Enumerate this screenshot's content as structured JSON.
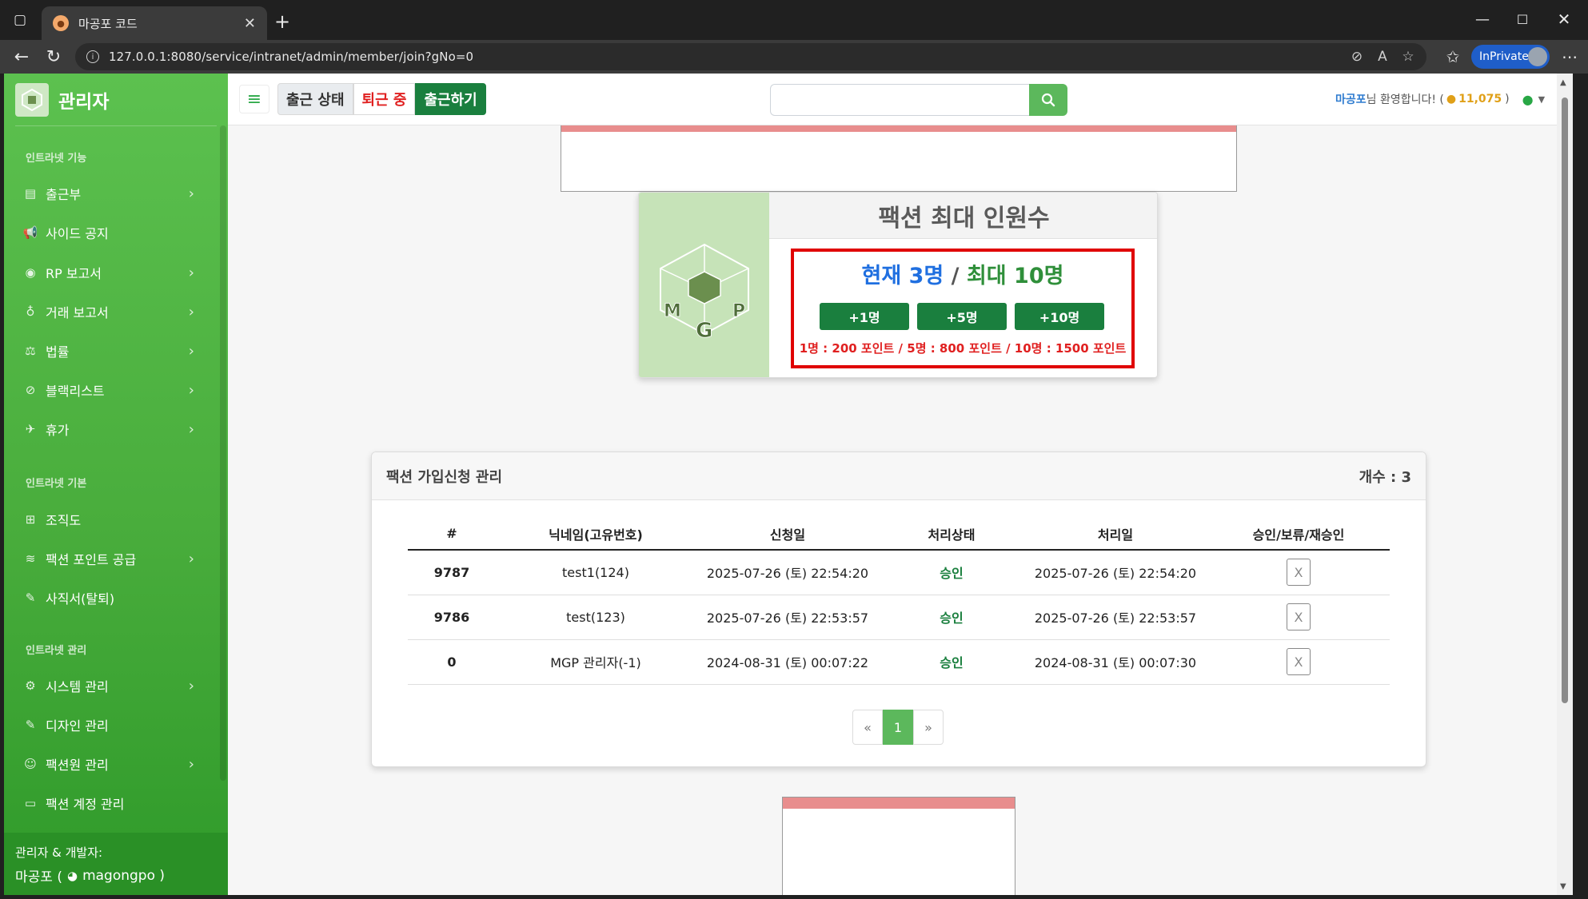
{
  "browser": {
    "tab_title": "마공포 코드",
    "url": "127.0.0.1:8080/service/intranet/admin/member/join?gNo=0",
    "inprivate_label": "InPrivate"
  },
  "sidebar": {
    "brand_title": "관리자",
    "sections": [
      {
        "heading": "인트라넷 기능",
        "items": [
          {
            "label": "출근부",
            "icon": "book-icon",
            "has_children": true
          },
          {
            "label": "사이드 공지",
            "icon": "megaphone-icon",
            "has_children": false
          },
          {
            "label": "RP 보고서",
            "icon": "gamepad-icon",
            "has_children": true
          },
          {
            "label": "거래 보고서",
            "icon": "moneybag-icon",
            "has_children": true
          },
          {
            "label": "법률",
            "icon": "scale-icon",
            "has_children": true
          },
          {
            "label": "블랙리스트",
            "icon": "ban-icon",
            "has_children": true
          },
          {
            "label": "휴가",
            "icon": "plane-icon",
            "has_children": true
          }
        ]
      },
      {
        "heading": "인트라넷 기본",
        "items": [
          {
            "label": "조직도",
            "icon": "sitemap-icon",
            "has_children": false
          },
          {
            "label": "팩션 포인트 공급",
            "icon": "coins-icon",
            "has_children": true
          },
          {
            "label": "사직서(탈퇴)",
            "icon": "feather-icon",
            "has_children": false
          }
        ]
      },
      {
        "heading": "인트라넷 관리",
        "items": [
          {
            "label": "시스템 관리",
            "icon": "gear-icon",
            "has_children": true
          },
          {
            "label": "디자인 관리",
            "icon": "brush-icon",
            "has_children": false
          },
          {
            "label": "팩션원 관리",
            "icon": "user-gear-icon",
            "has_children": true
          },
          {
            "label": "팩션 계정 관리",
            "icon": "id-card-icon",
            "has_children": false
          }
        ]
      }
    ],
    "footer": {
      "line1": "관리자 & 개발자:",
      "name": "마공포 (",
      "discord": "magongpo )"
    }
  },
  "topnav": {
    "status_label": "출근 상태",
    "status_value": "퇴근 중",
    "status_action": "출근하기",
    "search_value": "",
    "welcome_name": "마공포",
    "welcome_text": "님 환영합니다! (",
    "welcome_points": "11,075",
    "welcome_close": ")"
  },
  "faction_card": {
    "title": "팩션 최대 인원수",
    "current": "현재 3명",
    "separator": "/",
    "max": "최대 10명",
    "buttons": [
      "+1명",
      "+5명",
      "+10명"
    ],
    "price_text": "1명 : 200 포인트 / 5명 : 800 포인트 / 10명 : 1500 포인트"
  },
  "manage": {
    "title": "팩션 가입신청 관리",
    "count_label": "개수 : 3",
    "columns": [
      "#",
      "닉네임(고유번호)",
      "신청일",
      "처리상태",
      "처리일",
      "승인/보류/재승인"
    ],
    "rows": [
      {
        "no": "9787",
        "nick": "test1(124)",
        "applied": "2025-07-26 (토) 22:54:20",
        "status": "승인",
        "processed": "2025-07-26 (토) 22:54:20",
        "action": "X"
      },
      {
        "no": "9786",
        "nick": "test(123)",
        "applied": "2025-07-26 (토) 22:53:57",
        "status": "승인",
        "processed": "2025-07-26 (토) 22:53:57",
        "action": "X"
      },
      {
        "no": "0",
        "nick": "MGP 관리자(-1)",
        "applied": "2024-08-31 (토) 00:07:22",
        "status": "승인",
        "processed": "2024-08-31 (토) 00:07:30",
        "action": "X"
      }
    ],
    "pagination": {
      "prev": "«",
      "current": "1",
      "next": "»"
    }
  },
  "colors": {
    "sidebar_green": "#49ad3c",
    "action_green": "#1a7f3e",
    "highlight_red": "#e00000",
    "banner_strip": "#e88d8d"
  }
}
